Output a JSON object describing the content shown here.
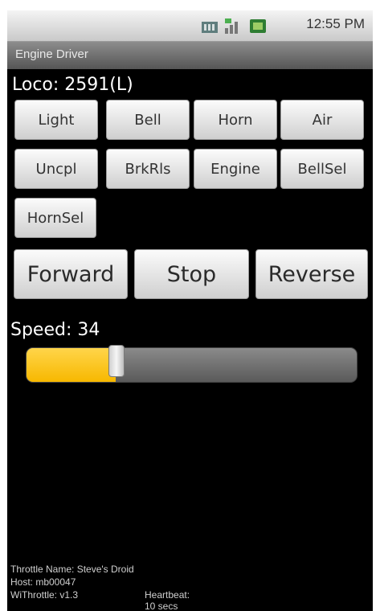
{
  "status_bar": {
    "time": "12:55 PM",
    "icons": [
      "signal-icon",
      "signal-bars-icon",
      "battery-icon"
    ]
  },
  "app": {
    "title": "Engine Driver"
  },
  "loco": {
    "label": "Loco: 2591(L)"
  },
  "functions": [
    "Light",
    "Bell",
    "Horn",
    "Air",
    "Uncpl",
    "BrkRls",
    "Engine",
    "BellSel",
    "HornSel"
  ],
  "direction": {
    "forward": "Forward",
    "stop": "Stop",
    "reverse": "Reverse"
  },
  "speed": {
    "label": "Speed:",
    "value": "34",
    "fraction": 0.27
  },
  "footer": {
    "throttle_name": "Throttle Name: Steve's Droid",
    "host": "Host: mb00047",
    "version": "WiThrottle: v1.3",
    "heartbeat": "Heartbeat: 10 secs"
  },
  "colors": {
    "slider_fill": "#f7b800",
    "background": "#000000"
  }
}
